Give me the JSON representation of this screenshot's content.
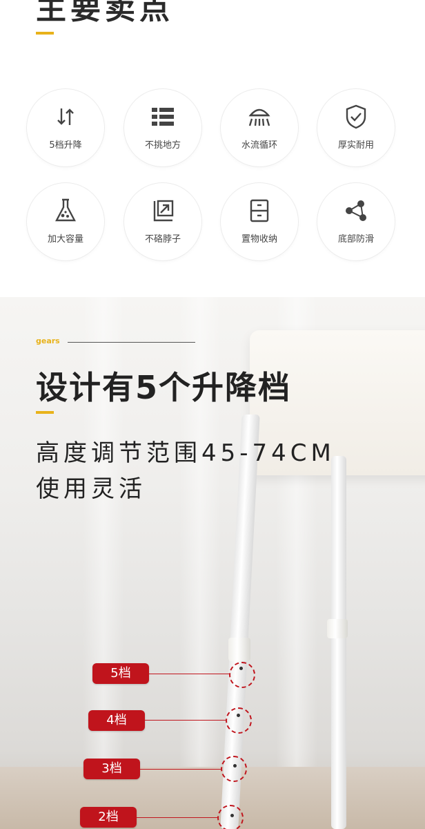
{
  "top": {
    "title": "主要卖点",
    "accent_color": "#e8b21a",
    "features": [
      {
        "label": "5档升降",
        "icon": "up-down-arrows-icon"
      },
      {
        "label": "不挑地方",
        "icon": "grid-list-icon"
      },
      {
        "label": "水流循环",
        "icon": "shower-head-icon"
      },
      {
        "label": "厚实耐用",
        "icon": "shield-check-icon"
      },
      {
        "label": "加大容量",
        "icon": "flask-icon"
      },
      {
        "label": "不硌脖子",
        "icon": "resize-corner-icon"
      },
      {
        "label": "置物收纳",
        "icon": "drawer-cabinet-icon"
      },
      {
        "label": "底部防滑",
        "icon": "nodes-connected-icon"
      }
    ]
  },
  "gears_section": {
    "tag": "gears",
    "headline": "设计有5个升降档",
    "line1": "高度调节范围45-74CM",
    "line2": "使用灵活",
    "marker_color": "#c0141c",
    "levels": [
      "5档",
      "4档",
      "3档",
      "2档"
    ]
  }
}
